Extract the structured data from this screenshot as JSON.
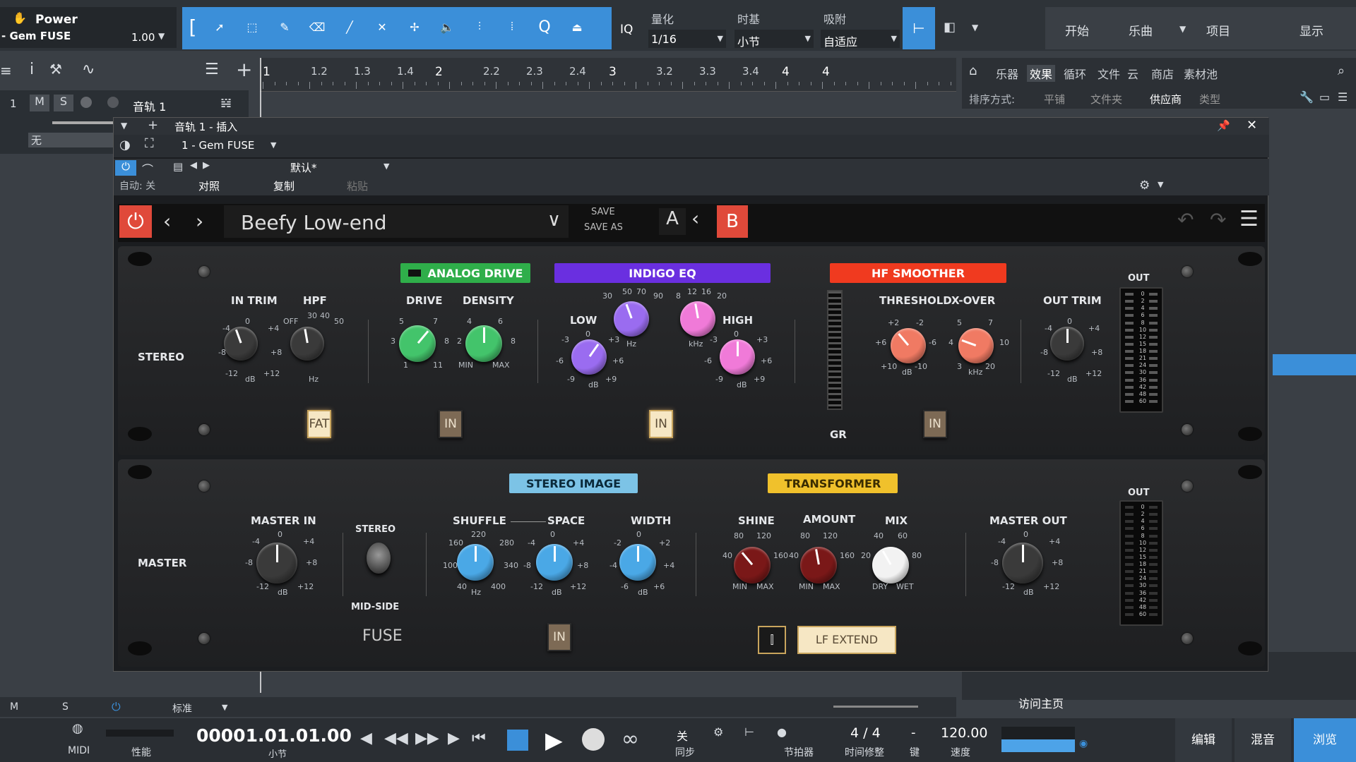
{
  "top_toolbar": {
    "track_title": "Power",
    "track_subtitle": "- Gem FUSE",
    "volume_value": "1.00",
    "quantize_label": "量化",
    "quantize_value": "1/16",
    "timebase_label": "时基",
    "timebase_value": "小节",
    "snap_label": "吸附",
    "snap_value": "自适应",
    "iq_label": "IQ",
    "nav": [
      "开始",
      "乐曲",
      "项目",
      "显示"
    ]
  },
  "ruler": {
    "marks": [
      "1",
      "1.2",
      "1.3",
      "1.4",
      "2",
      "2.2",
      "2.3",
      "2.4",
      "3",
      "3.2",
      "3.3",
      "3.4",
      "4",
      "4"
    ]
  },
  "track": {
    "number": "1",
    "mute": "M",
    "solo": "S",
    "name": "音轨 1",
    "input": "无"
  },
  "browser": {
    "tabs": [
      "乐器",
      "效果",
      "循环",
      "文件",
      "云",
      "商店",
      "素材池"
    ],
    "sort_label": "排序方式:",
    "sort_options": [
      "平铺",
      "文件夹",
      "供应商",
      "类型"
    ],
    "footer_link": "访问主页"
  },
  "insert_window": {
    "title": "音轨 1 - 插入",
    "device": "1 - Gem FUSE",
    "preset_default": "默认*",
    "auto_label": "自动: 关",
    "compare_label": "对照",
    "copy_label": "复制",
    "paste_label": "粘贴"
  },
  "plugin": {
    "preset_name": "Beefy Low-end",
    "save_label": "SAVE",
    "save_as_label": "SAVE AS",
    "a_label": "A",
    "b_label": "B",
    "stereo_section": {
      "row_label": "STEREO",
      "in_trim": "IN TRIM",
      "hpf": "HPF",
      "analog_drive": "ANALOG DRIVE",
      "drive": "DRIVE",
      "density": "DENSITY",
      "indigo_eq": "INDIGO EQ",
      "low": "LOW",
      "high": "HIGH",
      "hf_smoother": "HF SMOOTHER",
      "threshold": "THRESHOLD",
      "xover": "X-OVER",
      "out_trim": "OUT TRIM",
      "out": "OUT",
      "gr": "GR",
      "fat_label": "FAT",
      "in_label": "IN"
    },
    "master_section": {
      "row_label": "MASTER",
      "master_in": "MASTER IN",
      "stereo": "STEREO",
      "mid_side": "MID-SIDE",
      "stereo_image": "STEREO IMAGE",
      "shuffle": "SHUFFLE",
      "space": "SPACE",
      "width": "WIDTH",
      "transformer": "TRANSFORMER",
      "shine": "SHINE",
      "amount": "AMOUNT",
      "mix": "MIX",
      "master_out": "MASTER OUT",
      "out": "OUT",
      "lf_extend": "LF EXTEND",
      "fuse_logo": "FUSE",
      "in_label": "IN"
    }
  },
  "bottom_bar": {
    "mode_label": "标准",
    "midi_label": "MIDI",
    "perf_label": "性能",
    "time_display": "00001.01.01.00",
    "time_unit": "小节",
    "sync_label": "同步",
    "sync_value": "关",
    "metronome_label": "节拍器",
    "timesig_value": "4 / 4",
    "timesig_label": "时间修整",
    "key_label": "键",
    "key_value": "-",
    "tempo_value": "120.00",
    "tempo_label": "速度",
    "tabs": [
      "编辑",
      "混音",
      "浏览"
    ],
    "mini_m": "M",
    "mini_s": "S"
  },
  "colors": {
    "accent_blue": "#3b8fd9",
    "power_red": "#e0493a",
    "analog_drive": "#2fae4a",
    "indigo_eq": "#6a2fe0",
    "hf_smoother": "#f03a1f",
    "stereo_image": "#7cc3e6",
    "transformer": "#f0c12c"
  }
}
